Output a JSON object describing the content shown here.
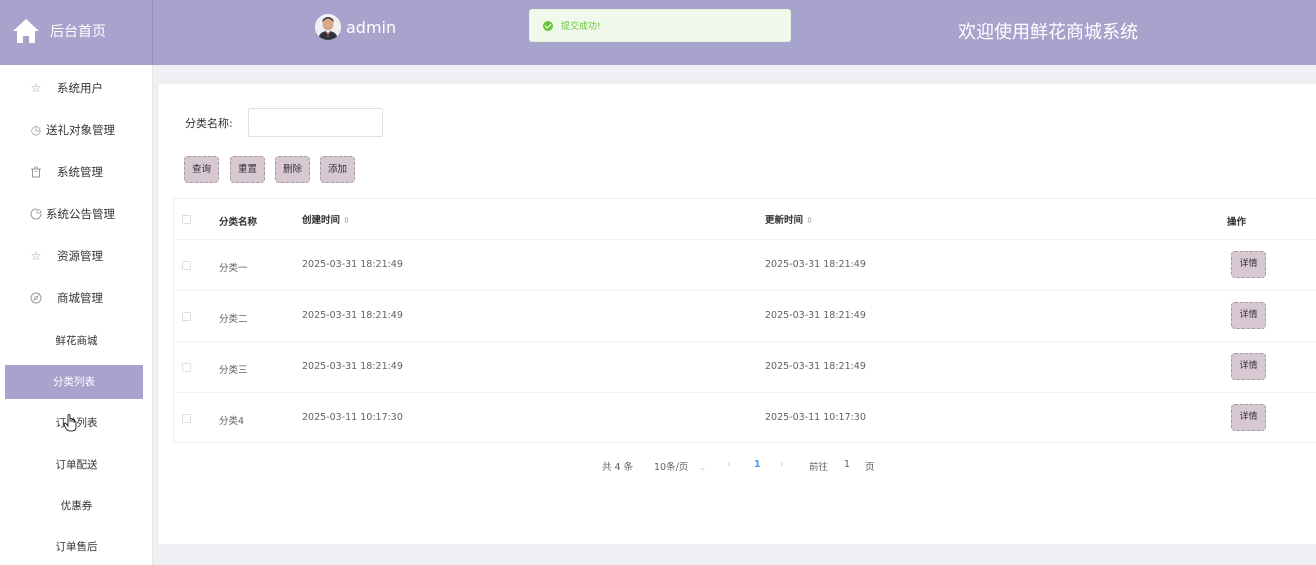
{
  "header": {
    "brand": "后台首页",
    "user": "admin",
    "toast": "提交成功!",
    "welcome": "欢迎使用鲜花商城系统"
  },
  "sidebar": {
    "items": [
      {
        "label": "系统用户",
        "icon": "star-outline-icon"
      },
      {
        "label": "送礼对象管理",
        "icon": "clock-icon"
      },
      {
        "label": "系统管理",
        "icon": "trash-icon"
      },
      {
        "label": "系统公告管理",
        "icon": "pie-icon"
      },
      {
        "label": "资源管理",
        "icon": "star-outline-icon"
      },
      {
        "label": "商城管理",
        "icon": "compass-icon"
      }
    ],
    "sub_items": [
      "鲜花商城",
      "分类列表",
      "订单列表",
      "订单配送",
      "优惠券",
      "订单售后"
    ],
    "active_sub": "分类列表"
  },
  "search": {
    "label": "分类名称:",
    "value": "",
    "placeholder": ""
  },
  "buttons": {
    "query": "查询",
    "reset": "重置",
    "delete": "删除",
    "add": "添加"
  },
  "table": {
    "headers": {
      "name": "分类名称",
      "created": "创建时间",
      "updated": "更新时间",
      "action": "操作"
    },
    "rows": [
      {
        "name": "分类一",
        "created": "2025-03-31 18:21:49",
        "updated": "2025-03-31 18:21:49",
        "action": "详情"
      },
      {
        "name": "分类二",
        "created": "2025-03-31 18:21:49",
        "updated": "2025-03-31 18:21:49",
        "action": "详情"
      },
      {
        "name": "分类三",
        "created": "2025-03-31 18:21:49",
        "updated": "2025-03-31 18:21:49",
        "action": "详情"
      },
      {
        "name": "分类4",
        "created": "2025-03-11 10:17:30",
        "updated": "2025-03-11 10:17:30",
        "action": "详情"
      }
    ]
  },
  "pagination": {
    "total": "共 4 条",
    "page_size": "10条/页",
    "current_page": "1",
    "goto_label": "前往",
    "goto_value": "1",
    "page_suffix": "页"
  },
  "colors": {
    "header_bg": "#a8a3cc",
    "active_bg": "#a8a3cc",
    "button_bg": "#d8c8d2",
    "success": "#67c23a",
    "pager_active": "#409eff"
  }
}
